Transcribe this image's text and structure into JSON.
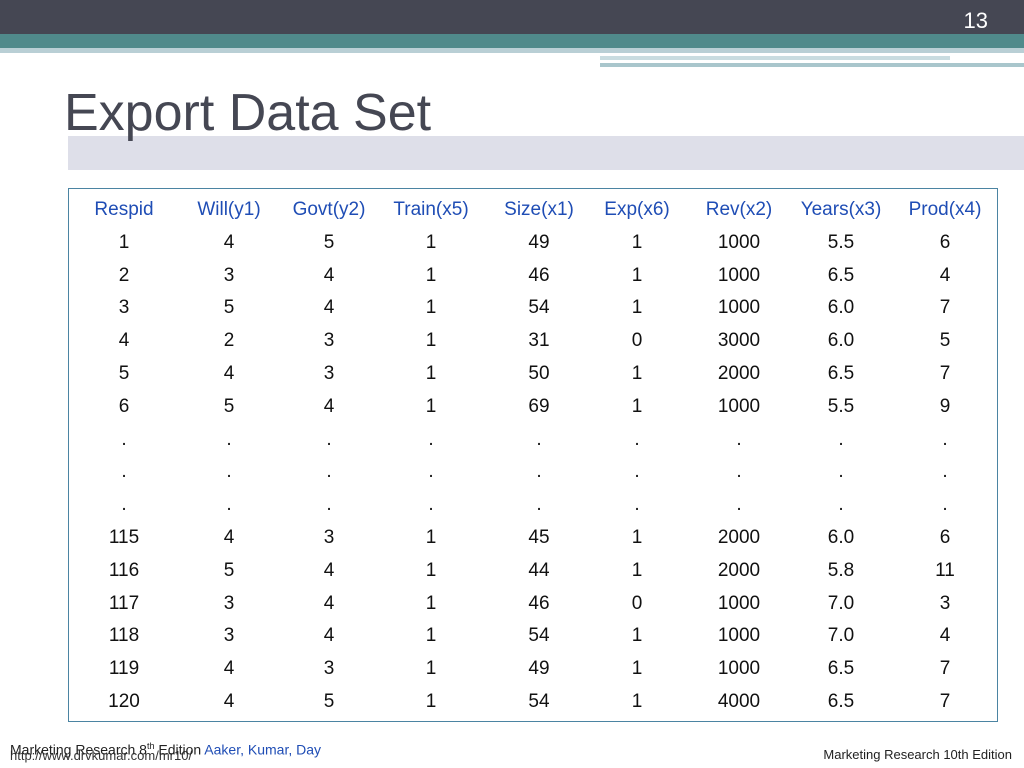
{
  "slide_number": "13",
  "title": "Export Data Set",
  "table": {
    "headers": [
      "Respid",
      "Will(y1)",
      "Govt(y2)",
      "Train(x5)",
      "Size(x1)",
      "Exp(x6)",
      "Rev(x2)",
      "Years(x3)",
      "Prod(x4)"
    ],
    "rows": [
      [
        "1",
        "4",
        "5",
        "1",
        "49",
        "1",
        "1000",
        "5.5",
        "6"
      ],
      [
        "2",
        "3",
        "4",
        "1",
        "46",
        "1",
        "1000",
        "6.5",
        "4"
      ],
      [
        "3",
        "5",
        "4",
        "1",
        "54",
        "1",
        "1000",
        "6.0",
        "7"
      ],
      [
        "4",
        "2",
        "3",
        "1",
        "31",
        "0",
        "3000",
        "6.0",
        "5"
      ],
      [
        "5",
        "4",
        "3",
        "1",
        "50",
        "1",
        "2000",
        "6.5",
        "7"
      ],
      [
        "6",
        "5",
        "4",
        "1",
        "69",
        "1",
        "1000",
        "5.5",
        "9"
      ],
      [
        ".",
        ".",
        ".",
        ".",
        ".",
        ".",
        ".",
        ".",
        "."
      ],
      [
        ".",
        ".",
        ".",
        ".",
        ".",
        ".",
        ".",
        ".",
        "."
      ],
      [
        ".",
        ".",
        ".",
        ".",
        ".",
        ".",
        ".",
        ".",
        "."
      ],
      [
        "115",
        "4",
        "3",
        "1",
        "45",
        "1",
        "2000",
        "6.0",
        "6"
      ],
      [
        "116",
        "5",
        "4",
        "1",
        "44",
        "1",
        "2000",
        "5.8",
        "11"
      ],
      [
        "117",
        "3",
        "4",
        "1",
        "46",
        "0",
        "1000",
        "7.0",
        "3"
      ],
      [
        "118",
        "3",
        "4",
        "1",
        "54",
        "1",
        "1000",
        "7.0",
        "4"
      ],
      [
        "119",
        "4",
        "3",
        "1",
        "49",
        "1",
        "1000",
        "6.5",
        "7"
      ],
      [
        "120",
        "4",
        "5",
        "1",
        "54",
        "1",
        "4000",
        "6.5",
        "7"
      ]
    ]
  },
  "footer": {
    "left_prefix": "Marketing Research 8",
    "left_sup": "th",
    "left_mid": " Edition ",
    "left_authors": "Aaker, Kumar, Day",
    "url": "http://www.drvkumar.com/mr10/",
    "right": "Marketing Research 10th Edition"
  }
}
